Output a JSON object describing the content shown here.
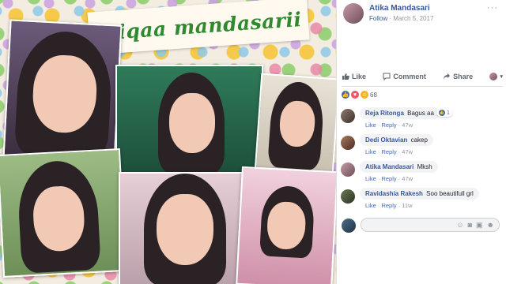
{
  "collage": {
    "banner_text": "atiqaa mandasarii"
  },
  "post": {
    "author": "Atika Mandasari",
    "follow_label": "Follow",
    "date": "March 5, 2017",
    "separator": "·",
    "more_icon": "more-icon"
  },
  "actions": {
    "like": "Like",
    "comment": "Comment",
    "share": "Share"
  },
  "reactions": {
    "count": "68",
    "types": [
      "like",
      "love",
      "haha"
    ]
  },
  "comments": [
    {
      "name": "Reja Ritonga",
      "text": "Bagus aa",
      "like": "Like",
      "reply": "Reply",
      "time": "47w",
      "reaction_count": "1"
    },
    {
      "name": "Dedi Oktavian",
      "text": "cakep",
      "like": "Like",
      "reply": "Reply",
      "time": "47w"
    },
    {
      "name": "Atika Mandasari",
      "text": "Mksh",
      "like": "Like",
      "reply": "Reply",
      "time": "47w"
    },
    {
      "name": "Ravidashia Rakesh",
      "text": "Soo beautifull grl",
      "like": "Like",
      "reply": "Reply",
      "time": "11w"
    }
  ],
  "colors": {
    "link": "#365899",
    "like_blue": "#4267b2",
    "love_red": "#f25268",
    "haha_yellow": "#f7b125",
    "muted": "#90949c"
  }
}
